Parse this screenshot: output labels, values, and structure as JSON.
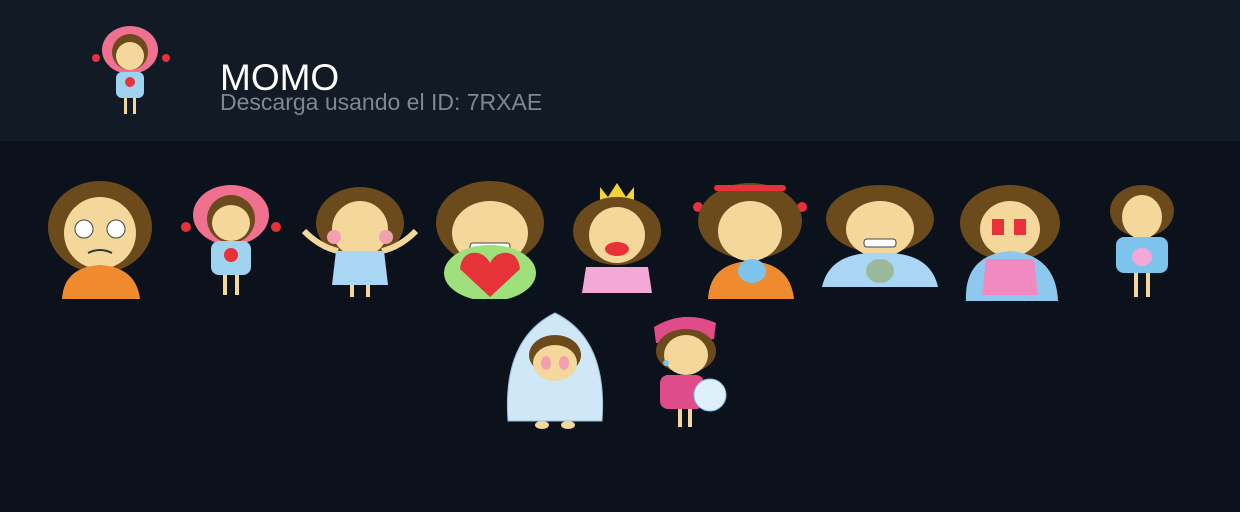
{
  "pack": {
    "title": "MOMO",
    "subtitle": "Descarga usando el ID: 7RXAE"
  },
  "colors": {
    "page_background": "#0c121b",
    "header_background": "#121a25",
    "title": "#ffffff",
    "subtitle": "#7f8792",
    "hair": "#6b4a1c",
    "skin": "#f4d79a"
  },
  "stickers": [
    {
      "icon": "momo-frown-orange-shirt-icon",
      "shirt": "#f08a2e"
    },
    {
      "icon": "momo-hearts-pink-hood-icon",
      "shirt": "#9fd3f0"
    },
    {
      "icon": "momo-shrug-blue-dress-icon",
      "shirt": "#a8d6f4"
    },
    {
      "icon": "momo-grin-holding-heart-icon",
      "shirt": "#9de07c"
    },
    {
      "icon": "momo-crown-kiss-icon",
      "shirt": "#f3a8d8"
    },
    {
      "icon": "momo-angry-coffee-icon",
      "shirt": "#f08a2e"
    },
    {
      "icon": "momo-grin-cup-blanket-icon",
      "shirt": "#a8d6f4"
    },
    {
      "icon": "momo-crying-blanket-icon",
      "shirt": "#f08ac0"
    },
    {
      "icon": "momo-holding-bunny-icon",
      "shirt": "#7cc4ec"
    },
    {
      "icon": "momo-under-blanket-icon",
      "shirt": "#cfe7f6"
    },
    {
      "icon": "momo-sad-rain-icon",
      "shirt": "#e04b8a"
    }
  ]
}
